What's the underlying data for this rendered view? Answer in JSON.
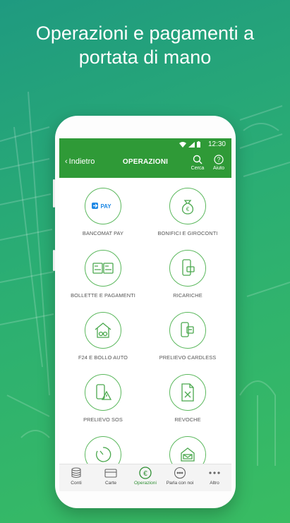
{
  "headline": {
    "line1": "Operazioni e pagamenti a",
    "line2": "portata di mano"
  },
  "statusbar": {
    "time": "12:30"
  },
  "appbar": {
    "back_label": "Indietro",
    "title": "OPERAZIONI",
    "search_label": "Cerca",
    "help_label": "Aiuto"
  },
  "operations": [
    {
      "label": "BANCOMAT PAY",
      "icon": "bancomat-pay-icon",
      "badge": "PAY"
    },
    {
      "label": "BONIFICI E GIROCONTI",
      "icon": "money-bag-icon"
    },
    {
      "label": "BOLLETTE E PAGAMENTI",
      "icon": "bills-icon"
    },
    {
      "label": "RICARICHE",
      "icon": "phone-recharge-icon"
    },
    {
      "label": "F24 E BOLLO AUTO",
      "icon": "house-tax-icon"
    },
    {
      "label": "PRELIEVO CARDLESS",
      "icon": "cardless-withdrawal-icon"
    },
    {
      "label": "PRELIEVO SOS",
      "icon": "sos-withdrawal-icon"
    },
    {
      "label": "REVOCHE",
      "icon": "revoke-document-icon"
    },
    {
      "label": "",
      "icon": "timer-icon"
    },
    {
      "label": "",
      "icon": "mail-icon"
    }
  ],
  "tabbar": {
    "tabs": [
      {
        "label": "Conti",
        "icon": "coins-icon"
      },
      {
        "label": "Carte",
        "icon": "card-icon"
      },
      {
        "label": "Operazioni",
        "icon": "euro-icon",
        "active": true
      },
      {
        "label": "Parla con noi",
        "icon": "chat-icon"
      },
      {
        "label": "Altro",
        "icon": "more-icon"
      }
    ]
  },
  "colors": {
    "brand_green": "#2f9a37",
    "icon_green": "#5bb85d",
    "bg_green": "#2bae73"
  }
}
